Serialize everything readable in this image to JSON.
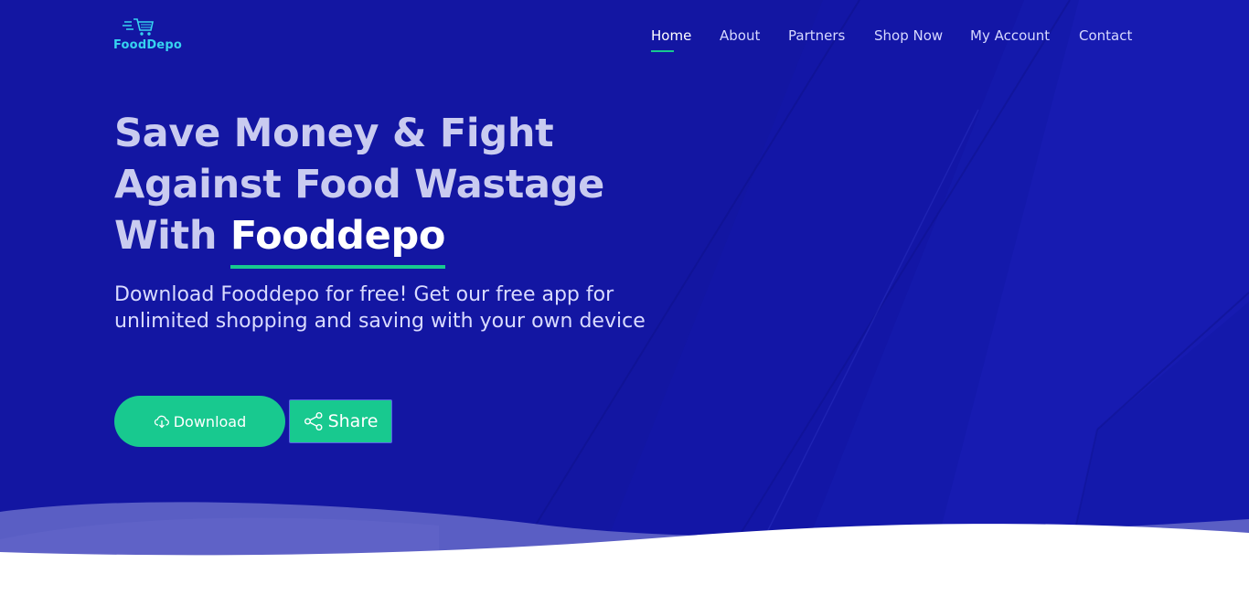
{
  "brand": {
    "logo_text": "FoodDepo",
    "logo_icon": "cart-icon"
  },
  "nav": {
    "items": [
      {
        "label": "Home",
        "active": true
      },
      {
        "label": "About",
        "active": false
      },
      {
        "label": "Partners",
        "active": false
      },
      {
        "label": "Shop Now",
        "active": false
      },
      {
        "label": "My Account",
        "active": false
      },
      {
        "label": "Contact",
        "active": false
      }
    ]
  },
  "hero": {
    "headline_line1": "Save Money & Fight",
    "headline_line2": "Against Food Wastage",
    "headline_line3_prefix": "With ",
    "headline_brand": "Fooddepo",
    "subtext": "Download Fooddepo for free! Get our free app for unlimited shopping and saving with your own device",
    "download_label": "Download",
    "download_icon": "cloud-download-icon",
    "share_label": "Share",
    "share_icon": "share-icon"
  },
  "colors": {
    "hero_background": "#1316a2",
    "accent_green": "#18c98f",
    "logo_cyan": "#36d3f0",
    "headline_text": "#c9cbf0",
    "white": "#ffffff"
  }
}
